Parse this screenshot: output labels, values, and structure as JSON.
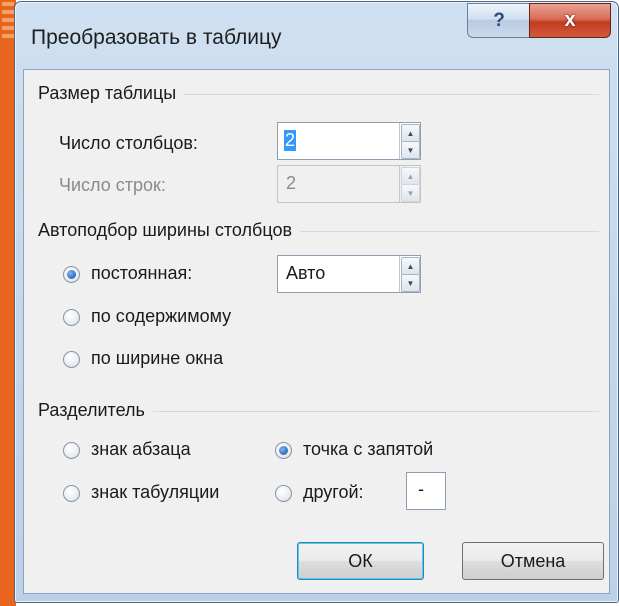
{
  "dialog": {
    "title": "Преобразовать в таблицу",
    "help_label": "?",
    "close_label": "x"
  },
  "table_size": {
    "heading": "Размер таблицы",
    "columns": {
      "label": "Число столбцов:",
      "value": "2"
    },
    "rows": {
      "label": "Число строк:",
      "value": "2",
      "disabled": true
    }
  },
  "autofit": {
    "heading": "Автоподбор ширины столбцов",
    "fixed": {
      "label": "постоянная:",
      "value": "Авто",
      "checked": true
    },
    "contents": {
      "label": "по содержимому",
      "checked": false
    },
    "window": {
      "label": "по ширине окна",
      "checked": false
    }
  },
  "separator": {
    "heading": "Разделитель",
    "paragraph": {
      "label": "знак абзаца",
      "checked": false
    },
    "semicolon": {
      "label": "точка с запятой",
      "checked": true
    },
    "tab": {
      "label": "знак табуляции",
      "checked": false
    },
    "other": {
      "label": "другой:",
      "value": "-",
      "checked": false
    }
  },
  "buttons": {
    "ok": "ОК",
    "cancel": "Отмена"
  },
  "colors": {
    "accent": "#e8651e",
    "close": "#c23c22",
    "selection": "#3399ff"
  }
}
